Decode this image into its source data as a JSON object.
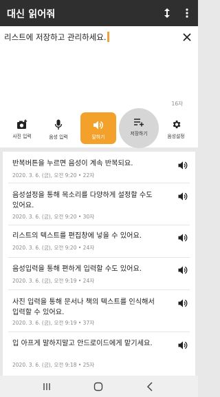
{
  "app": {
    "title": "대신 읽어줘"
  },
  "editor": {
    "text": "리스트에 저장하고 관리하세요.",
    "char_count": "16자"
  },
  "toolbar": {
    "items": [
      {
        "label": "사진 입력",
        "icon": "camera-plus-icon"
      },
      {
        "label": "음성 입력",
        "icon": "microphone-icon"
      },
      {
        "label": "말하기",
        "icon": "speaker-icon"
      },
      {
        "label": "저장하기",
        "icon": "playlist-add-icon"
      },
      {
        "label": "음성설정",
        "icon": "gear-icon"
      }
    ]
  },
  "list": {
    "items": [
      {
        "text": "반복버튼을 누르면 음성이 계속 반복되요.",
        "meta": "2020. 3. 6. (금), 오전 9:20 • 22자"
      },
      {
        "text": "음성설정을 통해 목소리를 다양하게 설정할 수도 있어요.",
        "meta": "2020. 3. 6. (금), 오전 9:20 • 30자"
      },
      {
        "text": "리스트의 텍스트를 편집창에 넣을 수 있어요.",
        "meta": "2020. 3. 6. (금), 오전 9:20 • 24자"
      },
      {
        "text": "음성입력을 통해 편하게 입력할 수도 있어요.",
        "meta": "2020. 3. 6. (금), 오전 9:19 • 24자"
      },
      {
        "text": "사진 입력을 통해 문서나 책의 텍스트를 인식해서 입력할 수 있어요.",
        "meta": "2020. 3. 6. (금), 오전 9:19 • 37자"
      },
      {
        "text": "입 아프게 말하지말고 안드로이드에게 맡기세요.",
        "meta": "2020. 3. 6. (금), 오전 9:18 • 25자"
      }
    ]
  },
  "colors": {
    "accent": "#f3a12a",
    "appbar": "#2f2f2f"
  }
}
